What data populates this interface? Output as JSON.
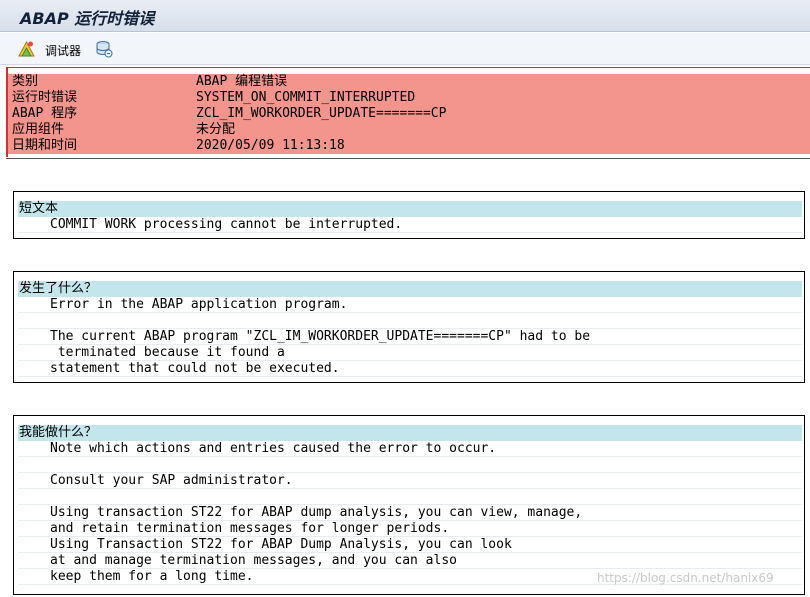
{
  "window": {
    "title": "ABAP 运行时错误"
  },
  "toolbar": {
    "debugger_label": "调试器"
  },
  "header": {
    "rows": [
      {
        "key": "类别",
        "value": "ABAP 编程错误"
      },
      {
        "key": "运行时错误",
        "value": "SYSTEM_ON_COMMIT_INTERRUPTED"
      },
      {
        "key": "ABAP 程序",
        "value": "ZCL_IM_WORKORDER_UPDATE=======CP"
      },
      {
        "key": "应用组件",
        "value": "未分配"
      },
      {
        "key": "日期和时间",
        "value": "2020/05/09 11:13:18"
      }
    ]
  },
  "short_text": {
    "title": "短文本",
    "lines": [
      "COMMIT WORK processing cannot be interrupted."
    ]
  },
  "what_happened": {
    "title": "发生了什么？",
    "lines": [
      "Error in the ABAP application program.",
      "",
      "The current ABAP program \"ZCL_IM_WORKORDER_UPDATE=======CP\" had to be",
      " terminated because it found a",
      "statement that could not be executed."
    ]
  },
  "what_to_do": {
    "title": "我能做什么？",
    "lines": [
      "Note which actions and entries caused the error to occur.",
      "",
      "Consult your SAP administrator.",
      "",
      "Using transaction ST22 for ABAP dump analysis, you can view, manage,",
      "and retain termination messages for longer periods.",
      "Using Transaction ST22 for ABAP Dump Analysis, you can look",
      "at and manage termination messages, and you can also",
      "keep them for a long time."
    ]
  },
  "watermark": "https://blog.csdn.net/hanix69"
}
